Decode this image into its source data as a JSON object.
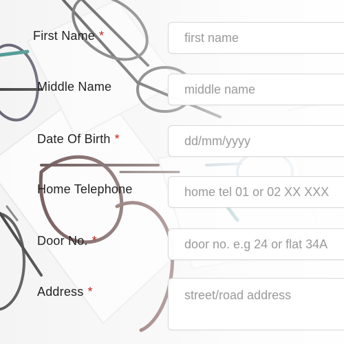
{
  "form": {
    "fields": [
      {
        "label": "First Name",
        "required_marker": "*",
        "placeholder": "first name",
        "value": ""
      },
      {
        "label": "Middle Name",
        "required_marker": "",
        "placeholder": "middle name",
        "value": ""
      },
      {
        "label": "Date Of Birth",
        "required_marker": "*",
        "placeholder": "dd/mm/yyyy",
        "value": ""
      },
      {
        "label": "Home Telephone",
        "required_marker": "",
        "placeholder": "home tel 01 or 02 XX XXX",
        "value": ""
      },
      {
        "label": "Door No.",
        "required_marker": "*",
        "placeholder": "door no. e.g 24 or flat 34A",
        "value": ""
      },
      {
        "label": "Address",
        "required_marker": "*",
        "placeholder": "street/road address",
        "value": ""
      }
    ]
  },
  "colors": {
    "required": "#c0261d",
    "label": "#222222",
    "placeholder": "#9a9a9a",
    "input_border": "#d9d9d9"
  },
  "background": {
    "icon": "eyeglasses-photo"
  }
}
